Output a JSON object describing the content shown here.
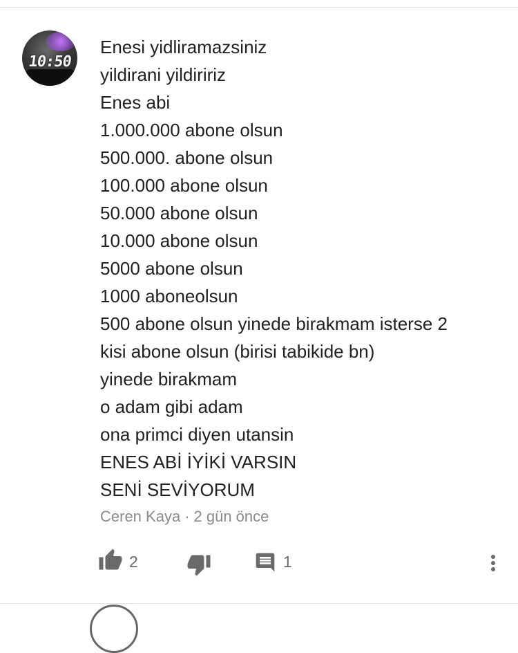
{
  "comment": {
    "avatar_text": "10:50",
    "lines": [
      "Enesi yidliramazsiniz",
      "yildirani yildiririz",
      "Enes abi",
      "1.000.000 abone  olsun",
      "500.000. abone olsun",
      "100.000 abone olsun",
      "50.000 abone olsun",
      "10.000 abone olsun",
      "5000 abone olsun",
      "1000 aboneolsun",
      "500 abone olsun yinede birakmam isterse 2",
      "kisi abone olsun (birisi tabikide bn)",
      "yinede birakmam",
      "o adam gibi adam",
      "ona primci diyen utansin",
      "ENES ABİ İYİKİ VARSIN",
      "SENİ SEVİYORUM"
    ],
    "author": "Ceren Kaya",
    "separator": "·",
    "time": "2 gün önce",
    "like_count": "2",
    "reply_count": "1"
  },
  "icons": {
    "like": "thumbs-up-icon",
    "dislike": "thumbs-down-icon",
    "reply": "comment-icon",
    "more": "more-vert-icon"
  },
  "colors": {
    "text": "#212121",
    "meta": "#8a8a8a",
    "icon": "#6a6a6a",
    "divider": "#e3e3e3"
  }
}
